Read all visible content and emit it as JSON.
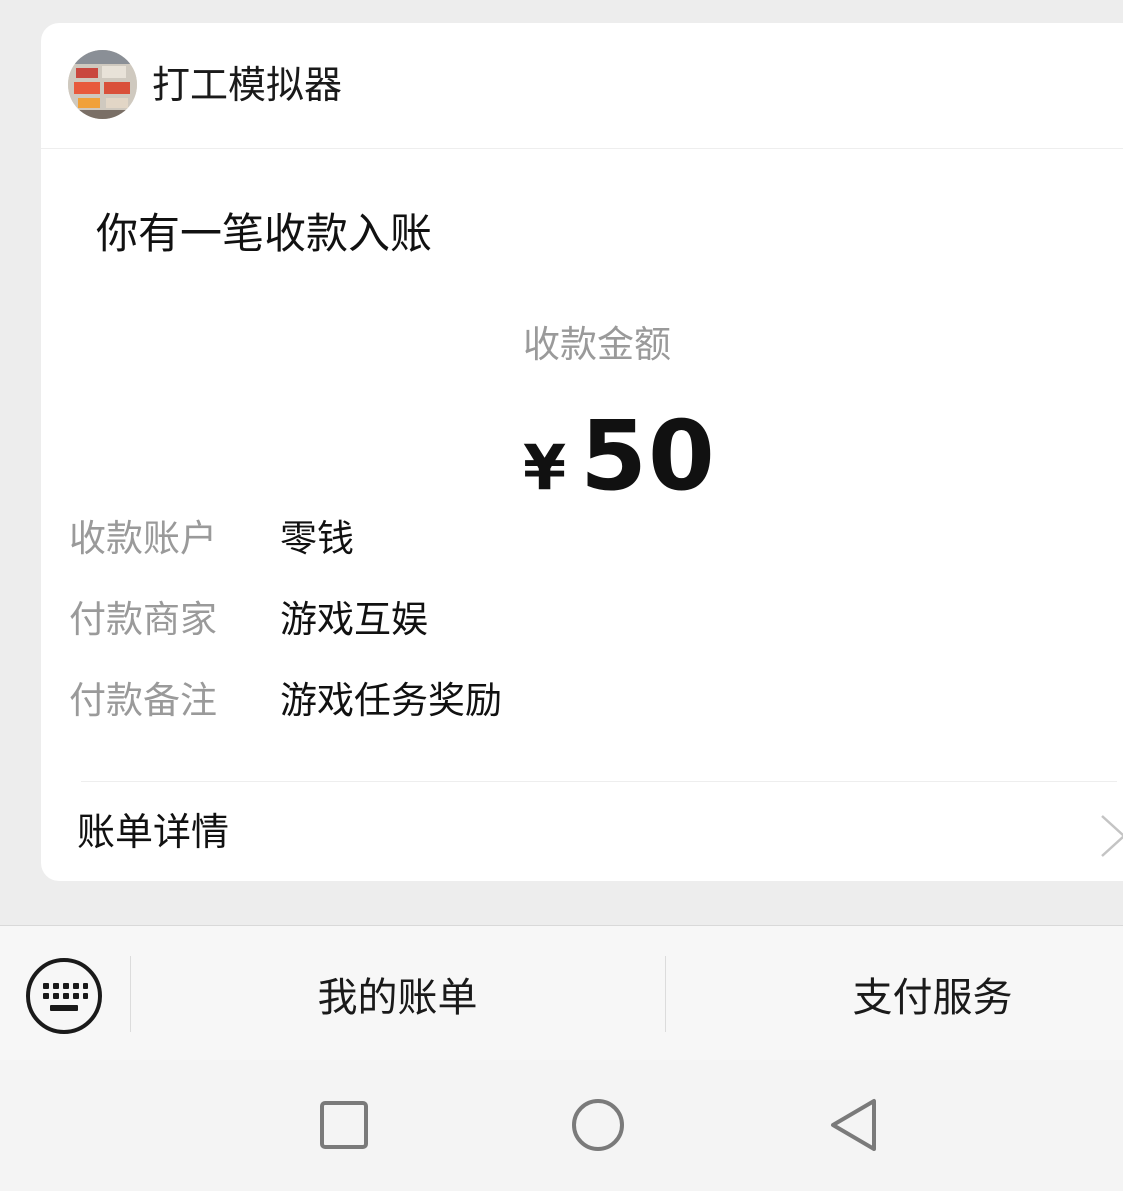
{
  "card": {
    "app_name": "打工模拟器",
    "avatar_icon": "game-avatar-icon",
    "headline": "你有一笔收款入账",
    "amount_label": "收款金额",
    "currency": "¥",
    "amount": "50",
    "details": [
      {
        "key": "收款账户",
        "value": "零钱"
      },
      {
        "key": "付款商家",
        "value": "游戏互娱"
      },
      {
        "key": "付款备注",
        "value": "游戏任务奖励"
      }
    ],
    "bill_detail_label": "账单详情"
  },
  "menu": {
    "keyboard_icon": "keyboard-icon",
    "items": [
      "我的账单",
      "支付服务"
    ]
  },
  "nav": {
    "icons": [
      "recent-apps-icon",
      "home-icon",
      "back-icon"
    ]
  },
  "colors": {
    "background": "#ededed",
    "card": "#ffffff",
    "secondary_text": "#9a9a9a",
    "primary_text": "#111111"
  }
}
